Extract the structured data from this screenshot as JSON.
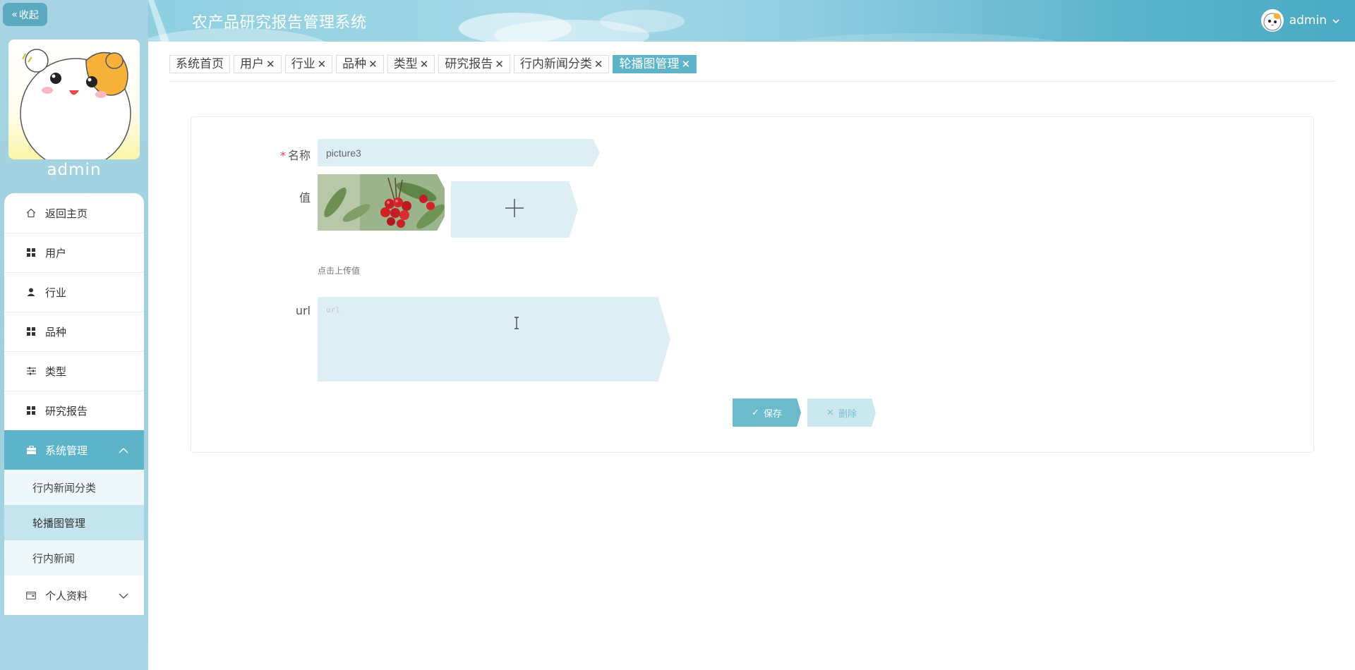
{
  "sidebar": {
    "collapse_label": "收起",
    "username": "admin",
    "menu": [
      {
        "label": "返回主页",
        "icon": "home-icon"
      },
      {
        "label": "用户",
        "icon": "grid-icon"
      },
      {
        "label": "行业",
        "icon": "person-icon"
      },
      {
        "label": "品种",
        "icon": "grid-icon"
      },
      {
        "label": "类型",
        "icon": "sliders-icon"
      },
      {
        "label": "研究报告",
        "icon": "grid-icon"
      },
      {
        "label": "系统管理",
        "icon": "briefcase-icon",
        "expanded": true,
        "active": true
      }
    ],
    "submenu": [
      {
        "label": "行内新闻分类"
      },
      {
        "label": "轮播图管理",
        "active": true
      },
      {
        "label": "行内新闻"
      }
    ],
    "profile_label": "个人资料",
    "profile_icon": "wallet-icon"
  },
  "header": {
    "title": "农产品研究报告管理系统",
    "user": "admin"
  },
  "tabs": [
    {
      "label": "系统首页",
      "closable": false
    },
    {
      "label": "用户",
      "closable": true
    },
    {
      "label": "行业",
      "closable": true
    },
    {
      "label": "品种",
      "closable": true
    },
    {
      "label": "类型",
      "closable": true
    },
    {
      "label": "研究报告",
      "closable": true
    },
    {
      "label": "行内新闻分类",
      "closable": true
    },
    {
      "label": "轮播图管理",
      "closable": true,
      "active": true
    }
  ],
  "form": {
    "name_label": "名称",
    "name_required_mark": "*",
    "name_value": "picture3",
    "value_label": "值",
    "upload_tip": "点击上传值",
    "url_label": "url",
    "url_placeholder": "url",
    "save_label": "保存",
    "delete_label": "删除"
  },
  "colors": {
    "accent": "#5db3c8",
    "field_bg": "#ddeff4",
    "sidebar_bg": "#a6d4e2",
    "required": "#e4393c"
  }
}
